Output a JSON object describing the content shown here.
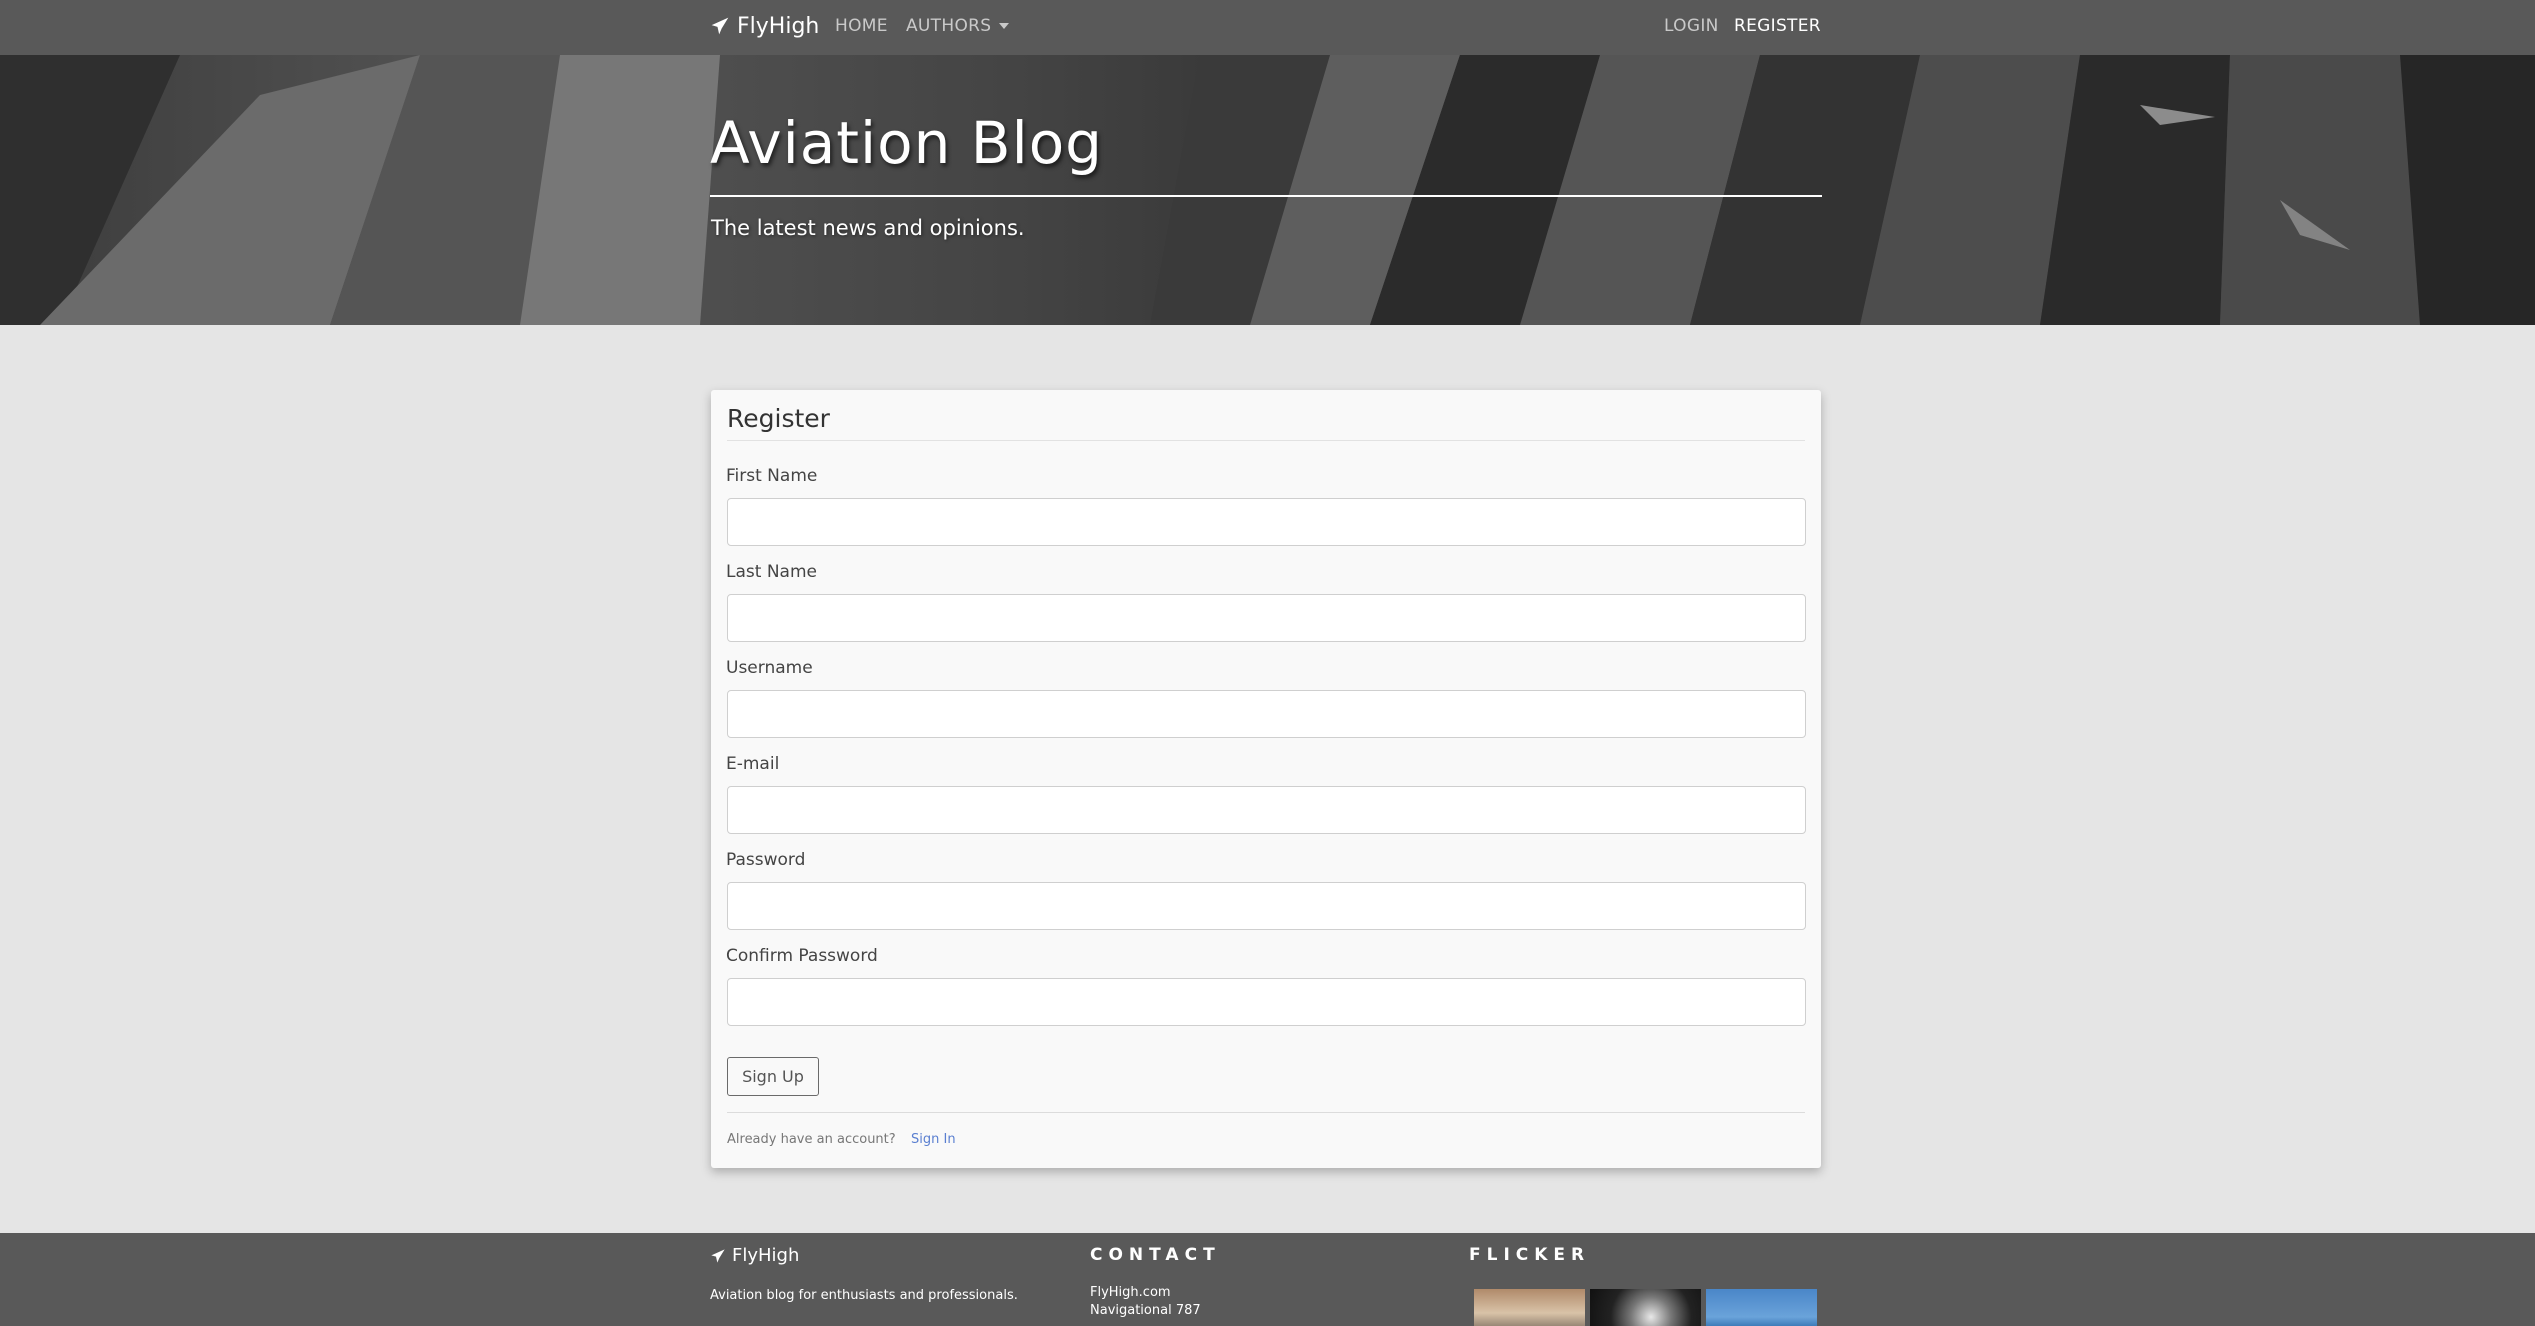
{
  "navbar": {
    "brand": "FlyHigh",
    "home": "HOME",
    "authors": "AUTHORS",
    "login": "LOGIN",
    "register": "REGISTER"
  },
  "hero": {
    "title": "Aviation Blog",
    "subtitle": "The latest news and opinions."
  },
  "form": {
    "title": "Register",
    "fields": [
      {
        "label": "First Name",
        "value": ""
      },
      {
        "label": "Last Name",
        "value": ""
      },
      {
        "label": "Username",
        "value": ""
      },
      {
        "label": "E-mail",
        "value": ""
      },
      {
        "label": "Password",
        "value": ""
      },
      {
        "label": "Confirm Password",
        "value": ""
      }
    ],
    "submit": "Sign Up",
    "already": "Already have an account?",
    "signin": "Sign In"
  },
  "footer": {
    "brand": "FlyHigh",
    "description": "Aviation blog for enthusiasts and professionals.",
    "contact_heading": "CONTACT",
    "contact_lines": [
      "FlyHigh.com",
      "Navigational 787"
    ],
    "flicker_heading": "FLICKER"
  },
  "colors": {
    "navbar": "#595959",
    "background": "#e5e5e5",
    "card": "#f9f9f9",
    "link": "#5a7fd0"
  },
  "icons": {
    "brand": "paper-plane-icon",
    "caret": "caret-down-icon"
  }
}
